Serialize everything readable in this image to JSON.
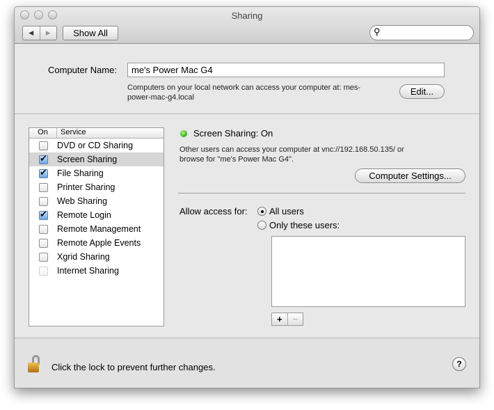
{
  "window": {
    "title": "Sharing"
  },
  "toolbar": {
    "back": "◀",
    "forward": "▶",
    "show_all": "Show All",
    "search_placeholder": ""
  },
  "computer_name": {
    "label": "Computer Name:",
    "value": "me's Power Mac G4",
    "info_line1": "Computers on your local network can access your computer at: mes-",
    "info_line2": "power-mac-g4.local",
    "edit_button": "Edit..."
  },
  "services": {
    "header_on": "On",
    "header_service": "Service",
    "items": [
      {
        "label": "DVD or CD Sharing",
        "checked": false
      },
      {
        "label": "Screen Sharing",
        "checked": true,
        "selected": true
      },
      {
        "label": "File Sharing",
        "checked": true
      },
      {
        "label": "Printer Sharing",
        "checked": false
      },
      {
        "label": "Web Sharing",
        "checked": false
      },
      {
        "label": "Remote Login",
        "checked": true
      },
      {
        "label": "Remote Management",
        "checked": false
      },
      {
        "label": "Remote Apple Events",
        "checked": false
      },
      {
        "label": "Xgrid Sharing",
        "checked": false
      },
      {
        "label": "Internet Sharing",
        "checked": false,
        "disabled": true
      }
    ]
  },
  "detail": {
    "status": "Screen Sharing: On",
    "status_color": "#3cb820",
    "desc_line1": "Other users can access your computer at vnc://192.168.50.135/ or",
    "desc_line2": "browse for \"me's Power Mac G4\".",
    "settings_button": "Computer Settings...",
    "allow_label": "Allow access for:",
    "all_users": "All users",
    "only_these": "Only these users:",
    "add": "+",
    "remove": "−"
  },
  "footer": {
    "lock_text": "Click the lock to prevent further changes.",
    "help": "?"
  }
}
